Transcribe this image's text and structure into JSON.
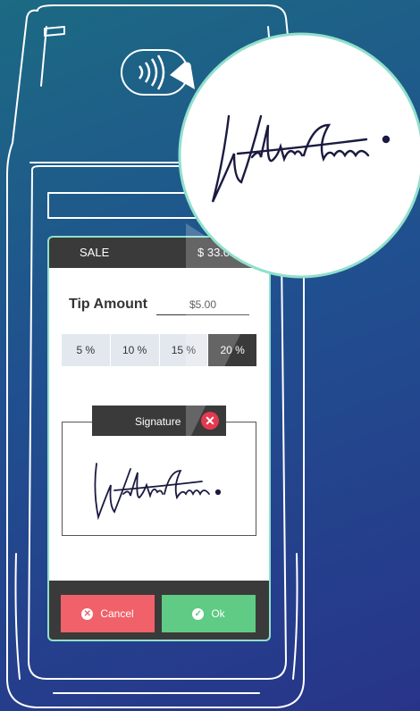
{
  "header": {
    "sale_label": "SALE",
    "sale_amount": "$ 33.00"
  },
  "tip": {
    "label": "Tip Amount",
    "value": "$5.00",
    "options": [
      "5 %",
      "10 %",
      "15 %",
      "20 %"
    ],
    "selected_option": "20 %"
  },
  "signature": {
    "tab_label": "Signature",
    "close_icon": "close-circle-icon",
    "signed_name": "Walter Gruman"
  },
  "actions": {
    "cancel_label": "Cancel",
    "cancel_icon": "close-circle-icon",
    "ok_label": "Ok",
    "ok_icon": "check-circle-icon"
  },
  "device": {
    "contactless_icon": "contactless-tap-icon"
  },
  "colors": {
    "background_top": "#1c6a83",
    "background_bottom": "#28348a",
    "screen_border": "#8fe0cc",
    "dark": "#3a3a3a",
    "cancel": "#f0616a",
    "ok": "#5fcb84",
    "close": "#e53950",
    "tip_button": "#e3e8ef"
  }
}
